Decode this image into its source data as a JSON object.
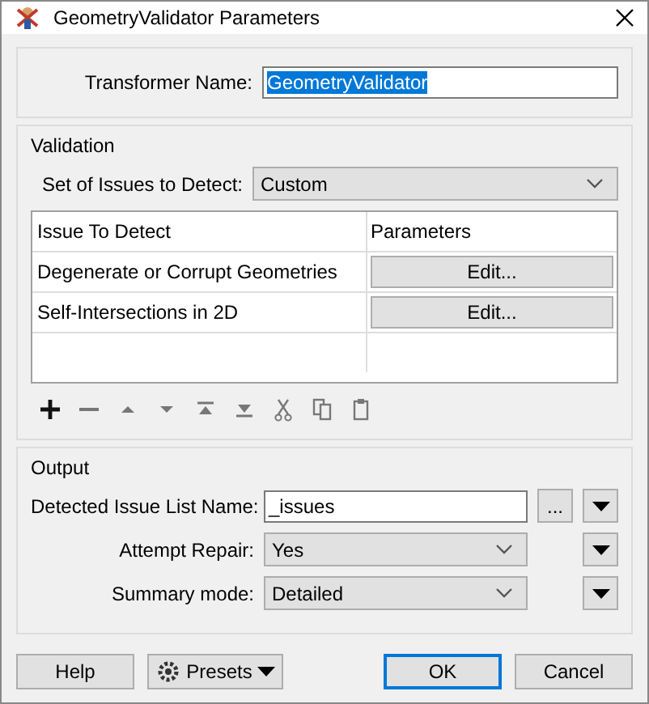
{
  "window": {
    "title": "GeometryValidator Parameters"
  },
  "transformer_name": {
    "label": "Transformer Name:",
    "value": "GeometryValidator",
    "selected": true
  },
  "validation": {
    "title": "Validation",
    "issue_set": {
      "label": "Set of Issues to Detect:",
      "value": "Custom"
    },
    "table": {
      "columns": [
        "Issue To Detect",
        "Parameters"
      ],
      "rows": [
        {
          "issue": "Degenerate or Corrupt Geometries",
          "button": "Edit..."
        },
        {
          "issue": "Self-Intersections in 2D",
          "button": "Edit..."
        }
      ]
    },
    "toolbar": [
      {
        "kind": "add",
        "disabled": false
      },
      {
        "kind": "remove",
        "disabled": true
      },
      {
        "kind": "up",
        "disabled": true
      },
      {
        "kind": "down",
        "disabled": true
      },
      {
        "kind": "top",
        "disabled": true
      },
      {
        "kind": "bottom",
        "disabled": true
      },
      {
        "kind": "cut",
        "disabled": true
      },
      {
        "kind": "copy",
        "disabled": true
      },
      {
        "kind": "paste",
        "disabled": true
      }
    ]
  },
  "output": {
    "title": "Output",
    "fields": [
      {
        "kind": "text",
        "label": "Detected Issue List Name:",
        "value": "_issues",
        "extra": "..."
      },
      {
        "kind": "select",
        "label": "Attempt Repair:",
        "value": "Yes"
      },
      {
        "kind": "select",
        "label": "Summary mode:",
        "value": "Detailed"
      }
    ]
  },
  "buttons": [
    {
      "kind": "help",
      "label": "Help"
    },
    {
      "kind": "presets",
      "label": "Presets"
    },
    {
      "kind": "ok",
      "label": "OK"
    },
    {
      "kind": "cancel",
      "label": "Cancel"
    }
  ]
}
